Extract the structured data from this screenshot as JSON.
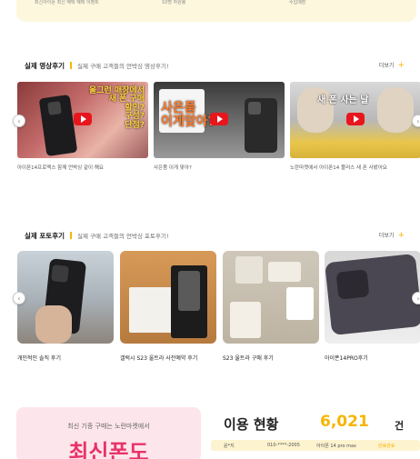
{
  "top_banner": {
    "col1": "최신아이폰 최신 혜택 혜택 이벤트",
    "col2": "10명 자원봉",
    "col3": "수입매장"
  },
  "video_section": {
    "title": "실제 영상후기",
    "subtitle": "실제 구매 고객들의 언박싱 영상후기!",
    "more": "더보기",
    "cards": [
      {
        "caption": "아이폰14프로맥스 함께 언박싱 같이 해요",
        "overlay": "울그런 매장에서\n새 폰 구매\n할인?\n구성?\n단점?"
      },
      {
        "caption": "사은품 이게 맞아?",
        "overlay": "사은품\n이게맞아?"
      },
      {
        "caption": "노란마켓에서 아이폰14 플러스 새 폰 사봤어요",
        "overlay": "새 폰 사는 날"
      }
    ]
  },
  "photo_section": {
    "title": "실제 포토후기",
    "subtitle": "실제 구매 고객들의 언박싱 포토후기!",
    "more": "더보기",
    "cards": [
      {
        "caption": "개인적인 솔직 후기"
      },
      {
        "caption": "갤럭시 S23 울트라 사전예약 후기"
      },
      {
        "caption": "S23 울트라 구매 후기"
      },
      {
        "caption": "아이폰14PRO후기"
      }
    ]
  },
  "promo": {
    "sub": "최신 기종 구매는 노란마켓에서",
    "big": "최신폰도"
  },
  "stats": {
    "title": "이용 현황",
    "count": "6,021",
    "unit": "건",
    "row": {
      "name": "윤*지",
      "phone": "010-****-2005",
      "model": "아이폰 14 pro max",
      "status": "완료완료"
    }
  },
  "colors": {
    "accent": "#f7b500",
    "play": "#e8161c",
    "promo_text": "#e8336a"
  }
}
